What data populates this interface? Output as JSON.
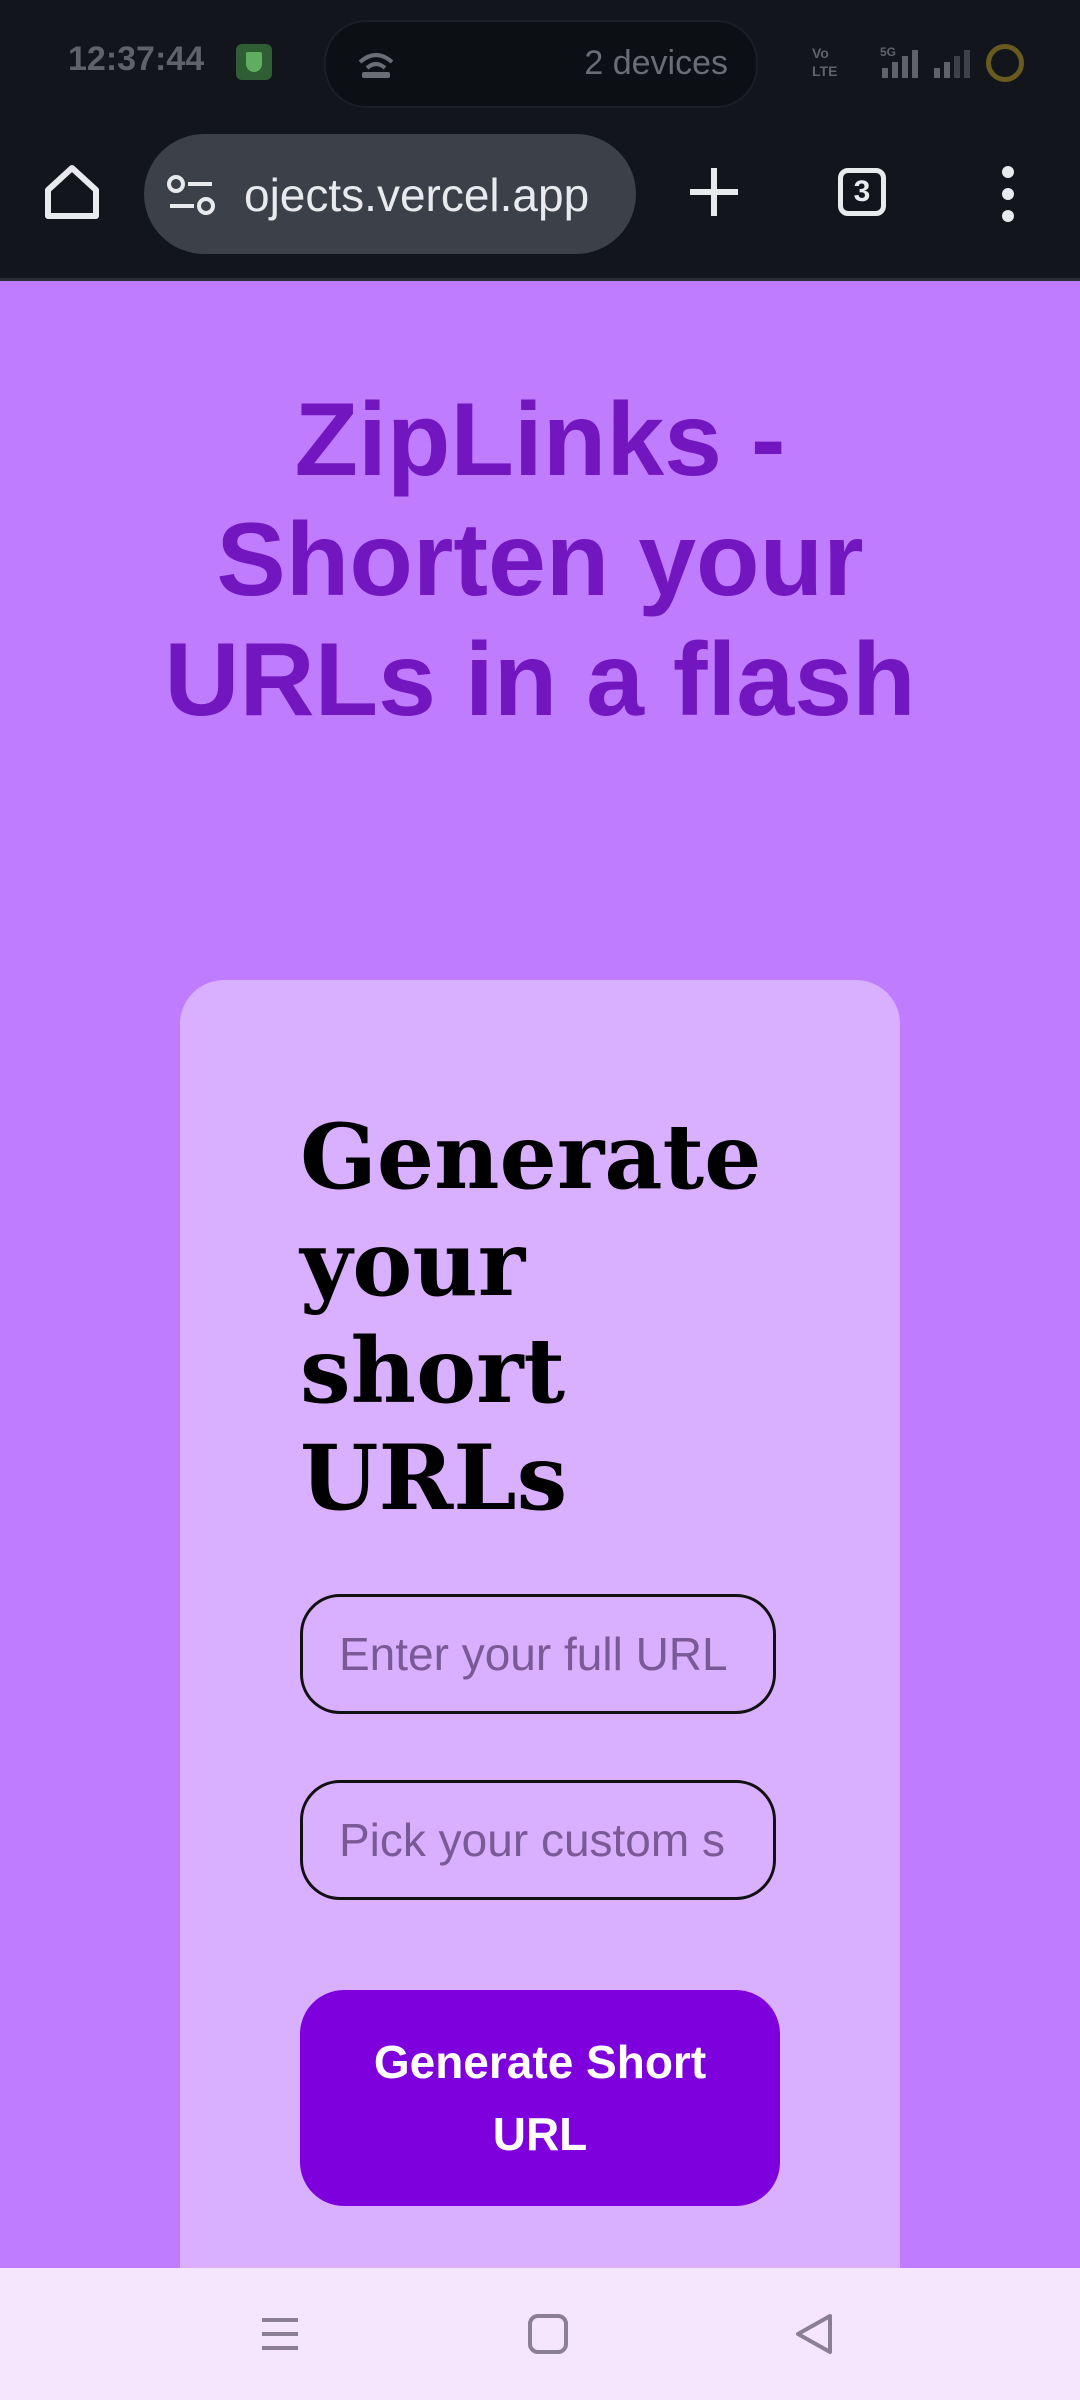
{
  "status_bar": {
    "time": "12:37:44",
    "devices_text": "2 devices",
    "network_label": "Vo LTE 5G"
  },
  "browser": {
    "url_display": "ojects.vercel.app",
    "tab_count": "3"
  },
  "page": {
    "title": "ZipLinks - Shorten your URLs in a flash",
    "card_heading": "Generate your short URLs",
    "url_placeholder": "Enter your full URL",
    "slug_placeholder": "Pick your custom s",
    "generate_label": "Generate Short URL"
  },
  "colors": {
    "page_bg": "#c07cff",
    "title": "#7216bf",
    "card_bg": "#d9b0ff",
    "button": "#7e00dd",
    "navbar": "#f5e6fd"
  },
  "icons": [
    "home-icon",
    "tune-icon",
    "plus-icon",
    "tabs-icon",
    "more-vert-icon",
    "menu-icon",
    "square-icon",
    "back-icon"
  ]
}
